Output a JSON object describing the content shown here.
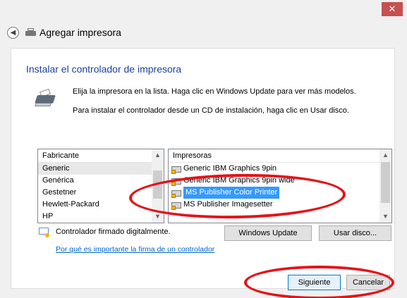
{
  "window": {
    "close_glyph": "✕",
    "title": "Agregar impresora"
  },
  "heading": "Instalar el controlador de impresora",
  "instructions": {
    "line1": "Elija la impresora en la lista. Haga clic en Windows Update para ver más modelos.",
    "line2": "Para instalar el controlador desde un CD de instalación, haga clic en Usar disco."
  },
  "manufacturers": {
    "header": "Fabricante",
    "items": [
      "Generic",
      "Genérica",
      "Gestetner",
      "Hewlett-Packard",
      "HP"
    ],
    "selected": "Generic"
  },
  "printers": {
    "header": "Impresoras",
    "items": [
      "Generic IBM Graphics 9pin",
      "Generic IBM Graphics 9pin wide",
      "MS Publisher Color Printer",
      "MS Publisher Imagesetter"
    ],
    "selected": "MS Publisher Color Printer"
  },
  "signature": {
    "status": "Controlador firmado digitalmente.",
    "link": "Por qué es importante la firma de un controlador"
  },
  "buttons": {
    "windows_update": "Windows Update",
    "have_disk": "Usar disco...",
    "next": "Siguiente",
    "cancel": "Cancelar"
  },
  "colors": {
    "heading": "#1e3f9a",
    "selection": "#3399ff",
    "link": "#0066cc",
    "annotation": "#e3141b",
    "close_button": "#c75050"
  }
}
